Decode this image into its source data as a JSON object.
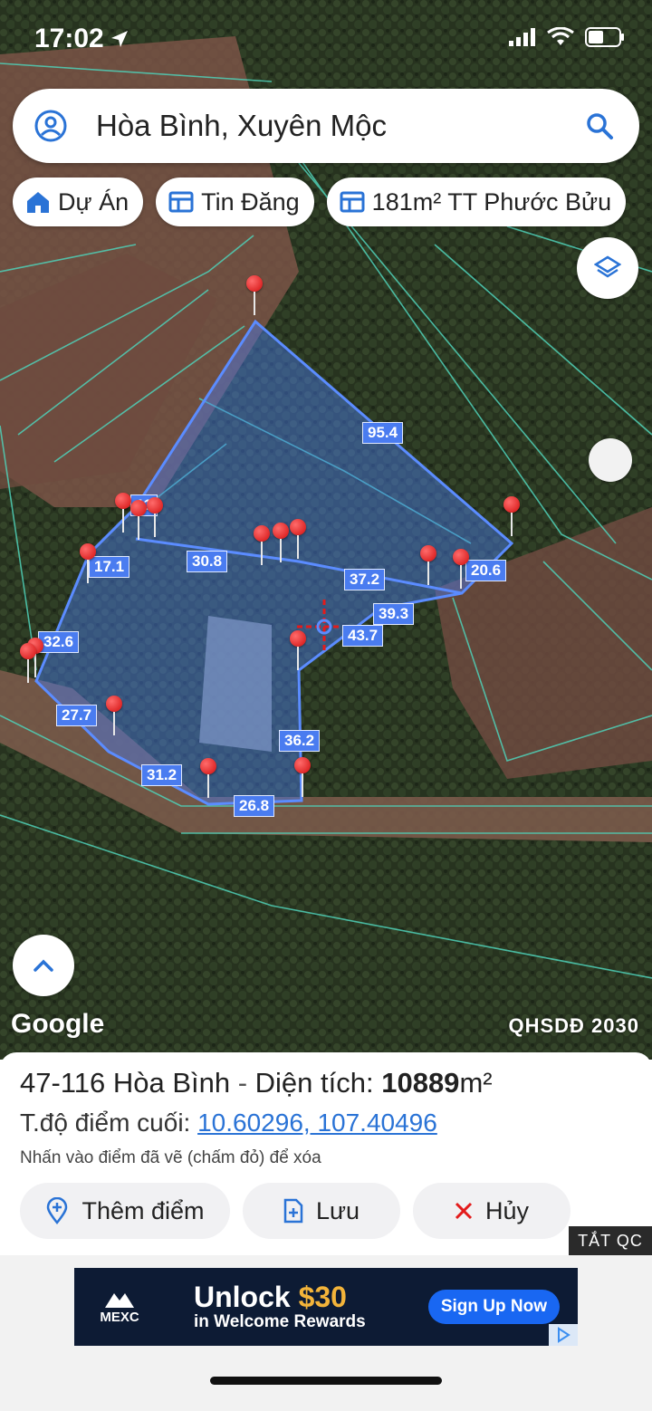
{
  "status": {
    "time": "17:02"
  },
  "search": {
    "value": "Hòa Bình, Xuyên Mộc"
  },
  "chips": [
    {
      "label": "Dự Án",
      "icon": "home-icon"
    },
    {
      "label": "Tin Đăng",
      "icon": "listing-icon"
    },
    {
      "label": "181m² TT Phước Bửu",
      "icon": "listing-icon"
    }
  ],
  "map": {
    "edge_labels": [
      "95.4",
      "20.6",
      "39.3",
      "43.7",
      "36.2",
      "26.8",
      "31.2",
      "27.7",
      "32.6",
      "17.1",
      "30.8",
      "37.2",
      "11"
    ],
    "attribution": "Google",
    "layer_name": "QHSDĐ 2030"
  },
  "info": {
    "parcel": "47-116 Hòa Bình",
    "separator": " - ",
    "area_label": "Diện tích: ",
    "area_value": "10889",
    "area_unit": "m²",
    "coord_label": "T.độ điểm cuối: ",
    "coord_value": "10.60296, 107.40496",
    "hint": "Nhấn vào điểm đã vẽ (chấm đỏ) để xóa"
  },
  "actions": {
    "add": "Thêm điểm",
    "save": "Lưu",
    "cancel": "Hủy"
  },
  "ad": {
    "brand": "MEXC",
    "headline": "Unlock ",
    "amount": "$30",
    "subline": "in Welcome Rewards",
    "cta": "Sign Up Now",
    "hide": "TẮT QC"
  },
  "colors": {
    "polygon": "#4a7cf0",
    "pin": "#e31b1b",
    "link": "#2a73d6",
    "ad_bg": "#0d1b34"
  }
}
